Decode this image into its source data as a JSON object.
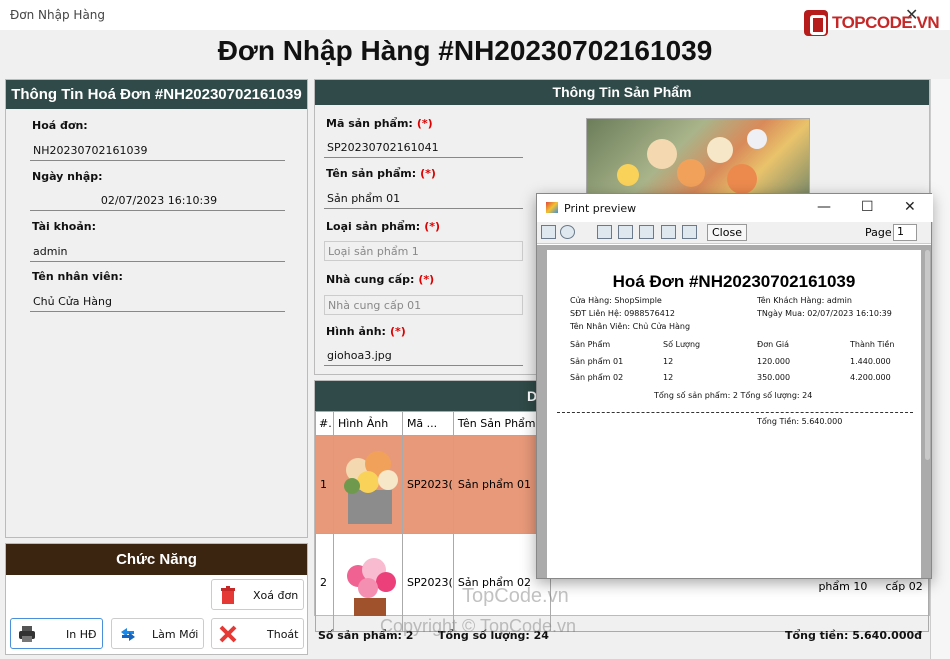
{
  "window": {
    "title": "Đơn Nhập Hàng",
    "brand": "TOPCODE.VN"
  },
  "main_title": "Đơn Nhập Hàng #NH20230702161039",
  "invoice": {
    "header": "Thông Tin Hoá Đơn #NH20230702161039",
    "label_invoice": "Hoá đơn:",
    "value_invoice": "NH20230702161039",
    "label_date": "Ngày nhập:",
    "value_date": "02/07/2023 16:10:39",
    "label_account": "Tài khoản:",
    "value_account": "admin",
    "label_staff": "Tên nhân viên:",
    "value_staff": "Chủ Cửa Hàng"
  },
  "functions": {
    "header": "Chức Năng",
    "delete_label": "Xoá đơn",
    "print_label": "In HĐ",
    "refresh_label": "Làm Mới",
    "exit_label": "Thoát"
  },
  "product": {
    "header": "Thông Tin Sản Phẩm",
    "label_code": "Mã sản phẩm:",
    "value_code": "SP20230702161041",
    "label_name": "Tên sản phẩm:",
    "value_name": "Sản phẩm 01",
    "label_type": "Loại sản phẩm:",
    "value_type": "Loại sản phẩm 1",
    "label_supplier": "Nhà cung cấp:",
    "value_supplier": "Nhà cung cấp 01",
    "label_image": "Hình ảnh:",
    "value_image": "giohoa3.jpg",
    "required_mark": "(*)"
  },
  "detail": {
    "header": "D",
    "columns": [
      "#.",
      "Hình Ảnh",
      "Mã ...",
      "Tên Sản Phẩm"
    ],
    "rows": [
      {
        "index": "1",
        "code": "SP2023(",
        "name": "Sản phẩm 01"
      },
      {
        "index": "2",
        "code": "SP2023(",
        "name": "Sản phẩm 02",
        "extra1": "phẩm 10",
        "extra2": "cấp 02"
      }
    ]
  },
  "footer": {
    "count": "Số sản phẩm: 2",
    "qty": "Tổng số lượng: 24",
    "total": "Tổng tiền: 5.640.000đ"
  },
  "print_preview": {
    "title": "Print preview",
    "close_label": "Close",
    "page_label": "Page",
    "page_value": "1",
    "paper": {
      "heading": "Hoá Đơn #NH20230702161039",
      "store": "Cửa Hàng: ShopSimple",
      "phone": "SĐT Liên Hệ: 0988576412",
      "staff": "Tên Nhân Viên: Chủ Cửa Hàng",
      "customer": "Tên Khách Hàng: admin",
      "date": "TNgày Mua: 02/07/2023 16:10:39",
      "columns": [
        "Sản Phẩm",
        "Số Lượng",
        "Đơn Giá",
        "Thành Tiền"
      ],
      "rows": [
        [
          "Sản phẩm 01",
          "12",
          "120.000",
          "1.440.000"
        ],
        [
          "Sản phẩm 02",
          "12",
          "350.000",
          "4.200.000"
        ]
      ],
      "summary": "Tổng số sản phẩm: 2  Tổng số lượng: 24",
      "total": "Tổng Tiền: 5.640.000"
    }
  },
  "watermarks": {
    "mid": "TopCode.vn",
    "bottom": "Copyright © TopCode.vn"
  }
}
